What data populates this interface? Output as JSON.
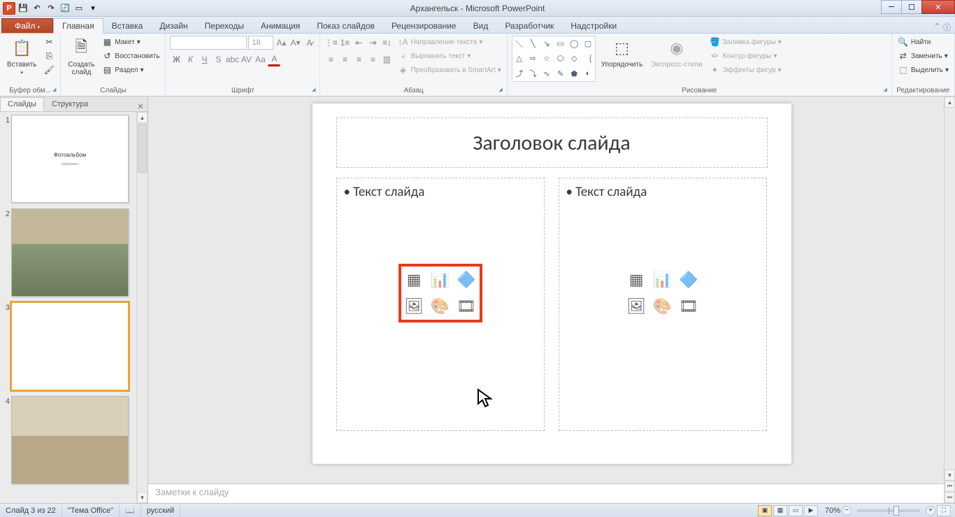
{
  "title_bar": {
    "app_letter": "P",
    "document_title": "Архангельск - Microsoft PowerPoint",
    "qat_icons": [
      "save",
      "undo",
      "redo",
      "refresh",
      "new-slide",
      "print"
    ]
  },
  "ribbon_tabs": {
    "file": "Файл",
    "tabs": [
      "Главная",
      "Вставка",
      "Дизайн",
      "Переходы",
      "Анимация",
      "Показ слайдов",
      "Рецензирование",
      "Вид",
      "Разработчик",
      "Надстройки"
    ],
    "active_index": 0
  },
  "ribbon_groups": {
    "clipboard": {
      "label": "Буфер обм...",
      "paste": "Вставить"
    },
    "slides": {
      "label": "Слайды",
      "new_slide": "Создать\nслайд",
      "layout": "Макет",
      "reset": "Восстановить",
      "section": "Раздел"
    },
    "font": {
      "label": "Шрифт",
      "font_size": "18"
    },
    "paragraph": {
      "label": "Абзац",
      "text_direction": "Направление текста",
      "align_text": "Выровнять текст",
      "convert_smartart": "Преобразовать в SmartArt"
    },
    "drawing": {
      "label": "Рисование",
      "arrange": "Упорядочить",
      "quick_styles": "Экспресс-стили",
      "shape_fill": "Заливка фигуры",
      "shape_outline": "Контур фигуры",
      "shape_effects": "Эффекты фигур"
    },
    "editing": {
      "label": "Редактирование",
      "find": "Найти",
      "replace": "Заменить",
      "select": "Выделить"
    }
  },
  "left_panel": {
    "tab_slides": "Слайды",
    "tab_outline": "Структура",
    "thumbs": [
      {
        "num": "1",
        "title": "Фотоальбом",
        "sub": "Spiridonov",
        "type": "title"
      },
      {
        "num": "2",
        "type": "image"
      },
      {
        "num": "3",
        "type": "blank",
        "selected": true
      },
      {
        "num": "4",
        "type": "image2"
      }
    ]
  },
  "slide": {
    "title_placeholder": "Заголовок слайда",
    "content_placeholder": "Текст слайда"
  },
  "notes": {
    "placeholder": "Заметки к слайду"
  },
  "status": {
    "slide_indicator": "Слайд 3 из 22",
    "theme": "\"Тема Office\"",
    "language": "русский",
    "zoom": "70%"
  }
}
